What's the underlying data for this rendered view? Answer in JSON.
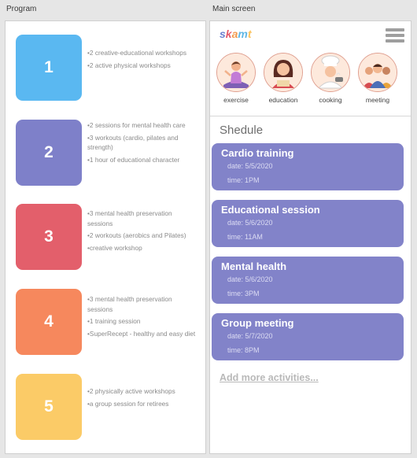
{
  "labels": {
    "program": "Program",
    "main_screen": "Main screen"
  },
  "programs": [
    {
      "number": "1",
      "color": "#5ab8f1",
      "items": [
        "2 creative-educational workshops",
        "2 active physical workshops"
      ]
    },
    {
      "number": "2",
      "color": "#7e80c9",
      "items": [
        "2 sessions for mental health care",
        "3 workouts (cardio, pilates and strength)",
        "1 hour of educational character"
      ]
    },
    {
      "number": "3",
      "color": "#e35f6b",
      "items": [
        "3 mental health preservation sessions",
        "2 workouts (aerobics and Pilates)",
        "creative workshop"
      ]
    },
    {
      "number": "4",
      "color": "#f6885d",
      "items": [
        "3 mental health preservation sessions",
        "1 training session",
        "SuperRecept - healthy and easy diet"
      ]
    },
    {
      "number": "5",
      "color": "#fbcb67",
      "items": [
        "2 physically active workshops",
        "a group session for retirees"
      ]
    }
  ],
  "app": {
    "logo_letters": [
      "s",
      "k",
      "a",
      "m",
      "t"
    ],
    "logo_colors": [
      "#6a7fd0",
      "#e45a6b",
      "#f39a4e",
      "#5fb7e6",
      "#fbc25a"
    ],
    "categories": [
      {
        "label": "exercise",
        "icon": "meditation-icon"
      },
      {
        "label": "education",
        "icon": "education-icon"
      },
      {
        "label": "cooking",
        "icon": "chef-icon"
      },
      {
        "label": "meeting",
        "icon": "group-icon"
      }
    ],
    "schedule_title": "Shedule",
    "events": [
      {
        "title": "Cardio training",
        "date": "date: 5/5/2020",
        "time": "time: 1PM"
      },
      {
        "title": "Educational session",
        "date": "date: 5/6/2020",
        "time": "time: 11AM"
      },
      {
        "title": "Mental health",
        "date": "date: 5/6/2020",
        "time": "time: 3PM"
      },
      {
        "title": "Group meeting",
        "date": "date: 5/7/2020",
        "time": "time: 8PM"
      }
    ],
    "add_more": "Add more activities..."
  }
}
